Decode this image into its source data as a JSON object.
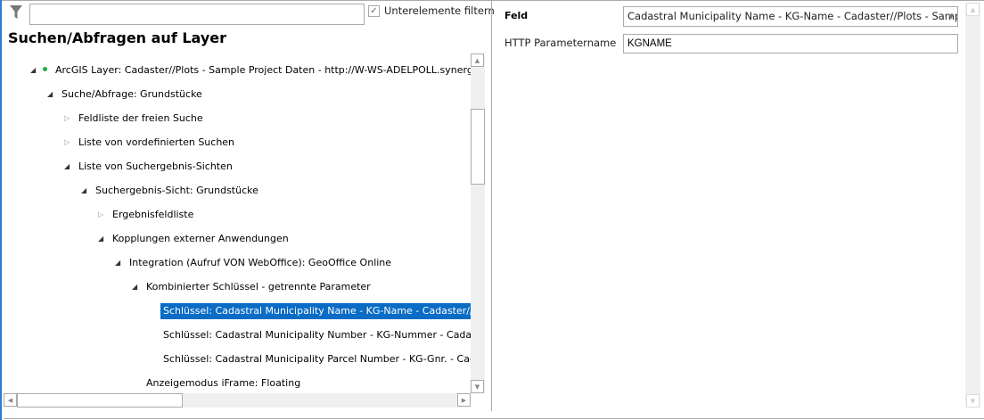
{
  "filter": {
    "input_value": "",
    "subfilter_label": "Unterelemente filtern",
    "subfilter_checked": true
  },
  "title": "Suchen/Abfragen auf Layer",
  "tree": [
    {
      "label": "ArcGIS Layer: Cadaster//Plots - Sample Project Daten - http://W-WS-ADELPOLL.synergis.intern",
      "level": 0,
      "arrow": "expanded",
      "dot": true
    },
    {
      "label": "Suche/Abfrage: Grundstücke",
      "level": 1,
      "arrow": "expanded"
    },
    {
      "label": "Feldliste der freien Suche",
      "level": 2,
      "arrow": "collapsed"
    },
    {
      "label": "Liste von vordefinierten Suchen",
      "level": 2,
      "arrow": "collapsed"
    },
    {
      "label": "Liste von Suchergebnis-Sichten",
      "level": 2,
      "arrow": "expanded"
    },
    {
      "label": "Suchergebnis-Sicht: Grundstücke",
      "level": 3,
      "arrow": "expanded"
    },
    {
      "label": "Ergebnisfeldliste",
      "level": 4,
      "arrow": "collapsed"
    },
    {
      "label": "Kopplungen externer Anwendungen",
      "level": 4,
      "arrow": "expanded"
    },
    {
      "label": "Integration (Aufruf VON WebOffice): GeoOffice Online",
      "level": 5,
      "arrow": "expanded"
    },
    {
      "label": "Kombinierter Schlüssel - getrennte Parameter",
      "level": 6,
      "arrow": "expanded"
    },
    {
      "label": "Schlüssel: Cadastral Municipality Name - KG-Name - Cadaster//Plots - Sample",
      "level": 7,
      "arrow": "none",
      "selected": true
    },
    {
      "label": "Schlüssel: Cadastral Municipality Number - KG-Nummer - Cadaster//Plots",
      "level": 7,
      "arrow": "none"
    },
    {
      "label": "Schlüssel: Cadastral Municipality Parcel Number - KG-Gnr. - Cadaster//Plots",
      "level": 7,
      "arrow": "none"
    },
    {
      "label": "Anzeigemodus iFrame: Floating",
      "level": 6,
      "arrow": "none"
    }
  ],
  "properties": {
    "feld_label": "Feld",
    "feld_value": "Cadastral Municipality Name - KG-Name - Cadaster//Plots - Sampl",
    "http_label": "HTTP Parametername",
    "http_value": "KGNAME"
  },
  "colors": {
    "selection": "#0a6cc5",
    "status_dot": "#1fb141",
    "accent": "#2b7cd3"
  }
}
